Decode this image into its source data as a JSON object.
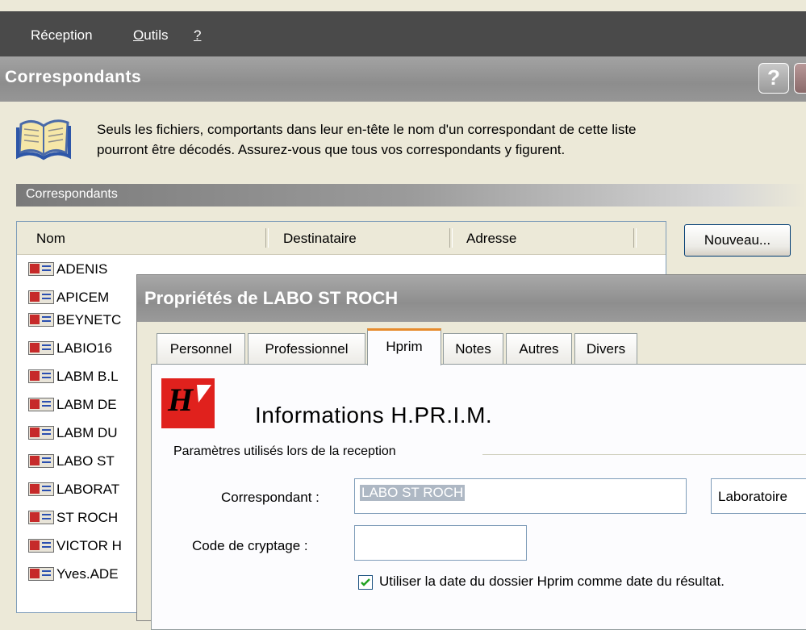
{
  "menu": {
    "items": [
      {
        "label": "Réception"
      },
      {
        "label": "Outils",
        "mnemonic": "O",
        "rest": "utils"
      },
      {
        "label": "?"
      }
    ]
  },
  "window": {
    "title": "Correspondants",
    "help_label": "?"
  },
  "info": {
    "line1": "Seuls les fichiers, comportants dans leur en-tête le nom d'un correspondant de cette liste",
    "line2": "pourront être décodés. Assurez-vous que tous vos correspondants y figurent."
  },
  "section": {
    "title": "Correspondants"
  },
  "list": {
    "columns": [
      "Nom",
      "Destinataire",
      "Adresse"
    ],
    "rows": [
      "ADENIS",
      "APICEM",
      "BEYNETC",
      "LABIO16",
      "LABM B.L",
      "LABM DE",
      "LABM DU",
      "LABO ST",
      "LABORAT",
      "ST ROCH",
      "VICTOR H",
      "Yves.ADE"
    ]
  },
  "buttons": {
    "new_label": "Nouveau..."
  },
  "dialog": {
    "title": "Propriétés de LABO ST ROCH",
    "tabs": [
      "Personnel",
      "Professionnel",
      "Hprim",
      "Notes",
      "Autres",
      "Divers"
    ],
    "active_tab": "Hprim",
    "heading": "Informations H.PR.I.M.",
    "group_label": "Paramètres utilisés lors de la reception",
    "correspondant_label": "Correspondant :",
    "correspondant_value": "LABO ST ROCH",
    "type_value": "Laboratoire",
    "crypt_label": "Code de cryptage :",
    "crypt_value": "",
    "checkbox_label": "Utiliser la date du dossier Hprim comme date du résultat.",
    "checkbox_checked": true,
    "logo_letter": "H"
  },
  "colors": {
    "accent_tab": "#e68b2c",
    "logo_red": "#e0211d",
    "menubar": "#4a4a4a"
  }
}
